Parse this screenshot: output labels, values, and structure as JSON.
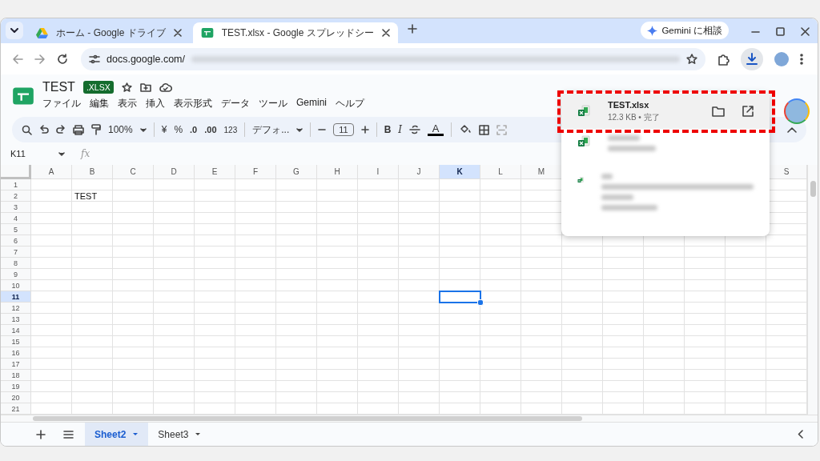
{
  "browser": {
    "tabs": [
      {
        "title": "ホーム - Google ドライブ",
        "selected": false
      },
      {
        "title": "TEST.xlsx - Google スプレッドシー",
        "selected": true
      }
    ],
    "gemini_button": "Gemini に相談",
    "address": {
      "url": "docs.google.com/"
    }
  },
  "document": {
    "title": "TEST",
    "badge": ".XLSX",
    "menu": [
      "ファイル",
      "編集",
      "表示",
      "挿入",
      "表示形式",
      "データ",
      "ツール",
      "Gemini",
      "ヘルプ"
    ]
  },
  "toolbar": {
    "zoom": "100%",
    "currency": "¥",
    "percent": "%",
    "decrease_decimal": ".0",
    "increase_decimal": ".00",
    "number_format": "123",
    "font": "デフォ...",
    "font_size": "11",
    "bold": "B",
    "italic": "I",
    "text_color": "A"
  },
  "formula_bar": {
    "name_box": "K11",
    "fx": "fx"
  },
  "grid": {
    "columns": [
      {
        "label": "A",
        "selected": false
      },
      {
        "label": "B",
        "selected": false
      },
      {
        "label": "C",
        "selected": false
      },
      {
        "label": "D",
        "selected": false
      },
      {
        "label": "E",
        "selected": false
      },
      {
        "label": "F",
        "selected": false
      },
      {
        "label": "G",
        "selected": false
      },
      {
        "label": "H",
        "selected": false
      },
      {
        "label": "I",
        "selected": false
      },
      {
        "label": "J",
        "selected": false
      },
      {
        "label": "K",
        "selected": true
      },
      {
        "label": "L",
        "selected": false
      },
      {
        "label": "M",
        "selected": false
      },
      null,
      null,
      null,
      null,
      null,
      {
        "label": "S",
        "selected": false
      }
    ],
    "rows": [
      {
        "label": "1",
        "selected": false,
        "cells": []
      },
      {
        "label": "2",
        "selected": false,
        "cells": [
          "",
          "TEST"
        ]
      },
      {
        "label": "3",
        "selected": false,
        "cells": []
      },
      {
        "label": "4",
        "selected": false,
        "cells": []
      },
      {
        "label": "5",
        "selected": false,
        "cells": []
      },
      {
        "label": "6",
        "selected": false,
        "cells": []
      },
      {
        "label": "7",
        "selected": false,
        "cells": []
      },
      {
        "label": "8",
        "selected": false,
        "cells": []
      },
      {
        "label": "9",
        "selected": false,
        "cells": []
      },
      {
        "label": "10",
        "selected": false,
        "cells": []
      },
      {
        "label": "11",
        "selected": true,
        "cells": []
      },
      {
        "label": "12",
        "selected": false,
        "cells": []
      },
      {
        "label": "13",
        "selected": false,
        "cells": []
      },
      {
        "label": "14",
        "selected": false,
        "cells": []
      },
      {
        "label": "15",
        "selected": false,
        "cells": []
      },
      {
        "label": "16",
        "selected": false,
        "cells": []
      },
      {
        "label": "17",
        "selected": false,
        "cells": []
      },
      {
        "label": "18",
        "selected": false,
        "cells": []
      },
      {
        "label": "19",
        "selected": false,
        "cells": []
      },
      {
        "label": "20",
        "selected": false,
        "cells": []
      },
      {
        "label": "21",
        "selected": false,
        "cells": []
      }
    ]
  },
  "sheets": [
    {
      "name": "Sheet2",
      "selected": true
    },
    {
      "name": "Sheet3",
      "selected": false
    }
  ],
  "downloads": [
    {
      "name": "TEST.xlsx",
      "detail": "12.3 KB • 完了",
      "blurred": false,
      "highlighted": true
    },
    {
      "blurred": true,
      "highlighted": false
    },
    {
      "blurred": true,
      "highlighted": false
    }
  ]
}
